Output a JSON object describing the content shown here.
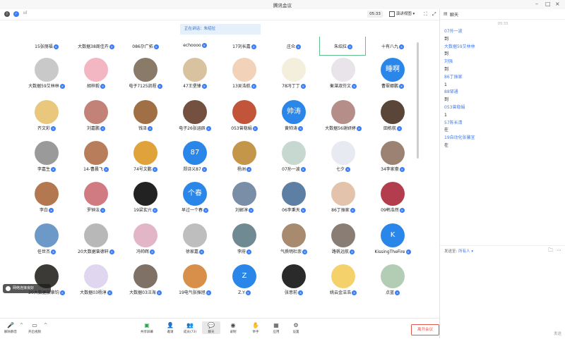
{
  "window": {
    "title": "腾讯会议"
  },
  "topbar": {
    "signal_label": "ııl",
    "timer": "05:33",
    "view_label": "演讲视图"
  },
  "banner": {
    "speaking": "正在讲话：朱绍拉"
  },
  "top_row_names": [
    {
      "name": "15张丽福"
    },
    {
      "name": "大数据38周佳卉"
    },
    {
      "name": "086尕广拓"
    },
    {
      "name": "echoooo"
    },
    {
      "name": "17刘长嘉"
    },
    {
      "name": "庄众"
    },
    {
      "name": "朱绍拉"
    },
    {
      "name": "十有八九"
    }
  ],
  "participants": [
    {
      "name": "大数据59艾林林",
      "avatar_text": "",
      "color": "#c9c9c9"
    },
    {
      "name": "胡梓毅",
      "avatar_text": "",
      "color": "#f3b7c4"
    },
    {
      "name": "电子7125凯程",
      "avatar_text": "",
      "color": "#8a7a68"
    },
    {
      "name": "47王堡锋",
      "avatar_text": "",
      "color": "#d8c2a0"
    },
    {
      "name": "13吴浩航",
      "avatar_text": "",
      "color": "#f2d2b8"
    },
    {
      "name": "78冯丁丁",
      "avatar_text": "",
      "color": "#f4efdc"
    },
    {
      "name": "衡湛淑芬文",
      "avatar_text": "",
      "color": "#e9e4ea"
    },
    {
      "name": "曹翠娜鹏",
      "avatar_text": "睡啊",
      "color": "#2a86e8"
    },
    {
      "name": "齐文彩",
      "avatar_text": "",
      "color": "#e9c77d"
    },
    {
      "name": "刘嘉鹏",
      "avatar_text": "",
      "color": "#c28277"
    },
    {
      "name": "钱泽",
      "avatar_text": "",
      "color": "#a06f46"
    },
    {
      "name": "电子26张涵辰",
      "avatar_text": "",
      "color": "#735040"
    },
    {
      "name": "053曾稳娟",
      "avatar_text": "",
      "color": "#c2543a"
    },
    {
      "name": "黄帅涛",
      "avatar_text": "帅涛",
      "color": "#2a86e8"
    },
    {
      "name": "大数据56谢妍婷",
      "avatar_text": "",
      "color": "#b58e8a"
    },
    {
      "name": "田栋航",
      "avatar_text": "",
      "color": "#5a4639"
    },
    {
      "name": "李嘉生",
      "avatar_text": "",
      "color": "#9a9a9a"
    },
    {
      "name": "14-曹晨飞",
      "avatar_text": "",
      "color": "#b87e5c"
    },
    {
      "name": "74号文鹏",
      "avatar_text": "",
      "color": "#e0a23a"
    },
    {
      "name": "郑诗义87",
      "avatar_text": "87",
      "color": "#2a86e8"
    },
    {
      "name": "杨洲",
      "avatar_text": "",
      "color": "#c4964a"
    },
    {
      "name": "07孙一波",
      "avatar_text": "",
      "color": "#c7d8d0"
    },
    {
      "name": "七夕",
      "avatar_text": "",
      "color": "#e8eaf2"
    },
    {
      "name": "34李家豪",
      "avatar_text": "",
      "color": "#9c8272"
    },
    {
      "name": "李白",
      "avatar_text": "",
      "color": "#b37850"
    },
    {
      "name": "罗钟法",
      "avatar_text": "",
      "color": "#d07a82"
    },
    {
      "name": "19梁玄兴",
      "avatar_text": "",
      "color": "#222222"
    },
    {
      "name": "早过一个春",
      "avatar_text": "个春",
      "color": "#2a86e8"
    },
    {
      "name": "刘郸淳",
      "avatar_text": "",
      "color": "#7b8ea8"
    },
    {
      "name": "06李秉天",
      "avatar_text": "",
      "color": "#5d7fa4"
    },
    {
      "name": "86丁振家",
      "avatar_text": "",
      "color": "#e4c3ad"
    },
    {
      "name": "09韩浩然",
      "avatar_text": "",
      "color": "#b33d4d"
    },
    {
      "name": "任世杰",
      "avatar_text": "",
      "color": "#6d99c9"
    },
    {
      "name": "20大数据曾德轩",
      "avatar_text": "",
      "color": "#b8b8b8"
    },
    {
      "name": "冯帅辉",
      "avatar_text": "",
      "color": "#e3b6c7"
    },
    {
      "name": "徐家嘉",
      "avatar_text": "",
      "color": "#bebebe"
    },
    {
      "name": "李府",
      "avatar_text": "",
      "color": "#6f8a92"
    },
    {
      "name": "气质明杜崇",
      "avatar_text": "",
      "color": "#a88b6f"
    },
    {
      "name": "路帆远航",
      "avatar_text": "",
      "color": "#8a7d73"
    },
    {
      "name": "KissingTheFire",
      "avatar_text": "K",
      "color": "#2a86e8"
    },
    {
      "name": "20大数据张章钧",
      "avatar_text": "",
      "color": "#3c3a37"
    },
    {
      "name": "大数据03杨淳",
      "avatar_text": "",
      "color": "#e0d6ef"
    },
    {
      "name": "大数据03汪海",
      "avatar_text": "",
      "color": "#807166"
    },
    {
      "name": "19电气张振旭",
      "avatar_text": "",
      "color": "#d88f4a"
    },
    {
      "name": "Z.Y",
      "avatar_text": "Z",
      "color": "#2a86e8"
    },
    {
      "name": "张意前",
      "avatar_text": "",
      "color": "#2a2a2a"
    },
    {
      "name": "姚云金洁浩",
      "avatar_text": "",
      "color": "#f4d16a"
    },
    {
      "name": "点蓝",
      "avatar_text": "",
      "color": "#b3ccb4"
    }
  ],
  "network": {
    "text": "网络连接良好"
  },
  "toolbar": {
    "mute_label": "解除静音",
    "video_label": "开启视频",
    "share_label": "共享屏幕",
    "invite_label": "邀请",
    "members_label": "成员(73)",
    "chat_label": "聊天",
    "record_label": "录制",
    "reactions_label": "举手",
    "apps_label": "应用",
    "settings_label": "设置",
    "end_label": "离开会议"
  },
  "chat": {
    "title": "聊天",
    "time": "05:33",
    "messages": [
      {
        "text": "07孙一波",
        "kind": "sender"
      },
      {
        "text": "到",
        "kind": "text"
      },
      {
        "text": "大数据59艾林林",
        "kind": "sender"
      },
      {
        "text": "到",
        "kind": "text"
      },
      {
        "text": "刘强",
        "kind": "sender"
      },
      {
        "text": "到",
        "kind": "text"
      },
      {
        "text": "86丁振家",
        "kind": "sender"
      },
      {
        "text": "1",
        "kind": "text"
      },
      {
        "text": "88邹通",
        "kind": "sender"
      },
      {
        "text": "到",
        "kind": "text"
      },
      {
        "text": "053曾稳娟",
        "kind": "sender"
      },
      {
        "text": "1",
        "kind": "text"
      },
      {
        "text": "57陈长清",
        "kind": "sender"
      },
      {
        "text": "在",
        "kind": "text"
      },
      {
        "text": "19自动化张馨宜",
        "kind": "sender"
      },
      {
        "text": "在",
        "kind": "text"
      }
    ],
    "send_to_label": "发送至:",
    "send_to_value": "所有人",
    "send_label": "发送"
  },
  "colors": {
    "accent": "#3a7cf5",
    "danger": "#e0564d",
    "bg": "#ffffff"
  }
}
